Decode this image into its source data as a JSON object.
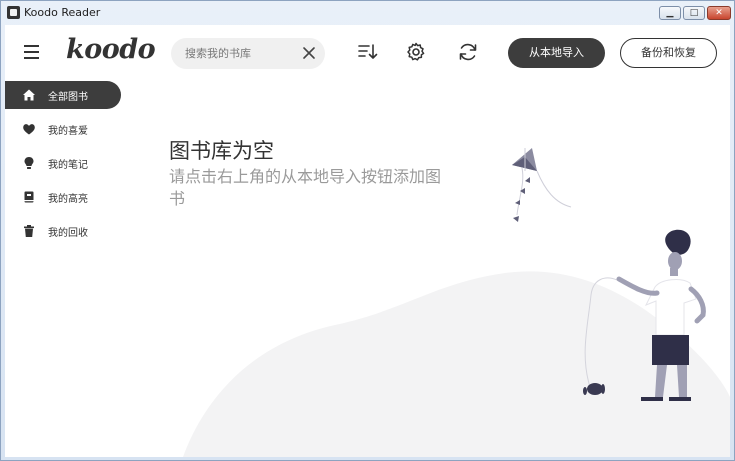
{
  "window": {
    "title": "Koodo Reader",
    "controls": {
      "minimize": "▁",
      "maximize": "□",
      "close": "✕"
    }
  },
  "header": {
    "logo": "koodo",
    "search": {
      "placeholder": "搜索我的书库",
      "value": ""
    },
    "tools": [
      "sort-icon",
      "settings-gear-icon",
      "sync-icon"
    ],
    "import_label": "从本地导入",
    "backup_label": "备份和恢复"
  },
  "sidebar": {
    "items": [
      {
        "label": "全部图书",
        "icon": "home-icon",
        "active": true
      },
      {
        "label": "我的喜爱",
        "icon": "heart-icon",
        "active": false
      },
      {
        "label": "我的笔记",
        "icon": "bulb-icon",
        "active": false
      },
      {
        "label": "我的高亮",
        "icon": "highlight-book-icon",
        "active": false
      },
      {
        "label": "我的回收",
        "icon": "trash-icon",
        "active": false
      }
    ]
  },
  "empty": {
    "title": "图书库为空",
    "description": "请点击右上角的从本地导入按钮添加图书"
  },
  "colors": {
    "accent": "#3d3d3d",
    "muted_text": "#9a9a9a",
    "illustration_fill": "#f2f2f3"
  }
}
